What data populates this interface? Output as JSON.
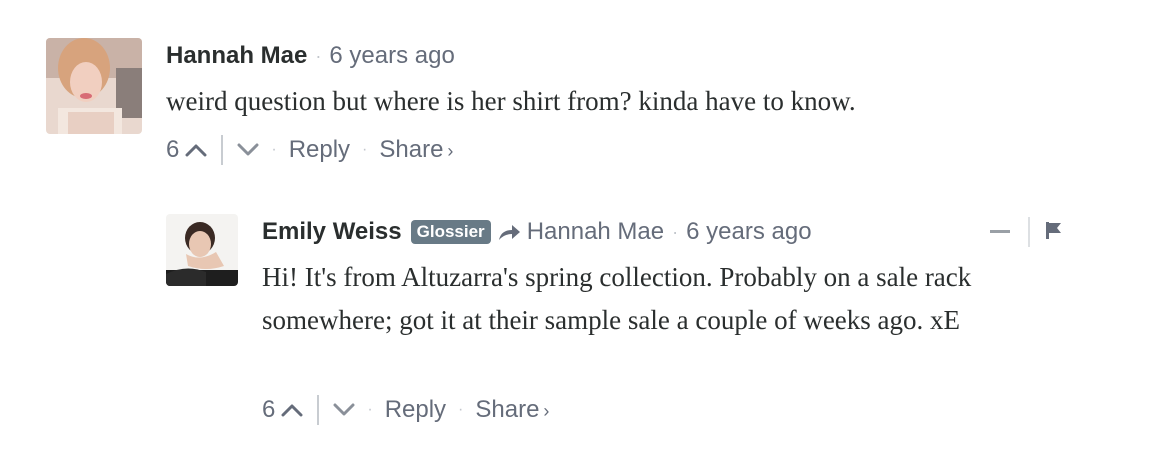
{
  "comments": [
    {
      "author": "Hannah Mae",
      "timestamp": "6 years ago",
      "text": "weird question but where is her shirt from? kinda have to know.",
      "votes": "6",
      "reply_label": "Reply",
      "share_label": "Share",
      "share_chevron": "›"
    },
    {
      "author": "Emily Weiss",
      "badge": "Glossier",
      "in_reply_to": "Hannah Mae",
      "timestamp": "6 years ago",
      "text": "Hi! It's from Altuzarra's spring collection. Probably on a sale rack somewhere; got it at their sample sale a couple of weeks ago. xE",
      "votes": "6",
      "reply_label": "Reply",
      "share_label": "Share",
      "share_chevron": "›"
    }
  ],
  "separator_dot": "·",
  "icons": {
    "upvote": "chevron-up-icon",
    "downvote": "chevron-down-icon",
    "reply_to": "reply-arrow-icon",
    "collapse": "minus-icon",
    "flag": "flag-icon"
  },
  "colors": {
    "text": "#2a2e2e",
    "muted": "#656c7a",
    "badge": "#687a86"
  }
}
